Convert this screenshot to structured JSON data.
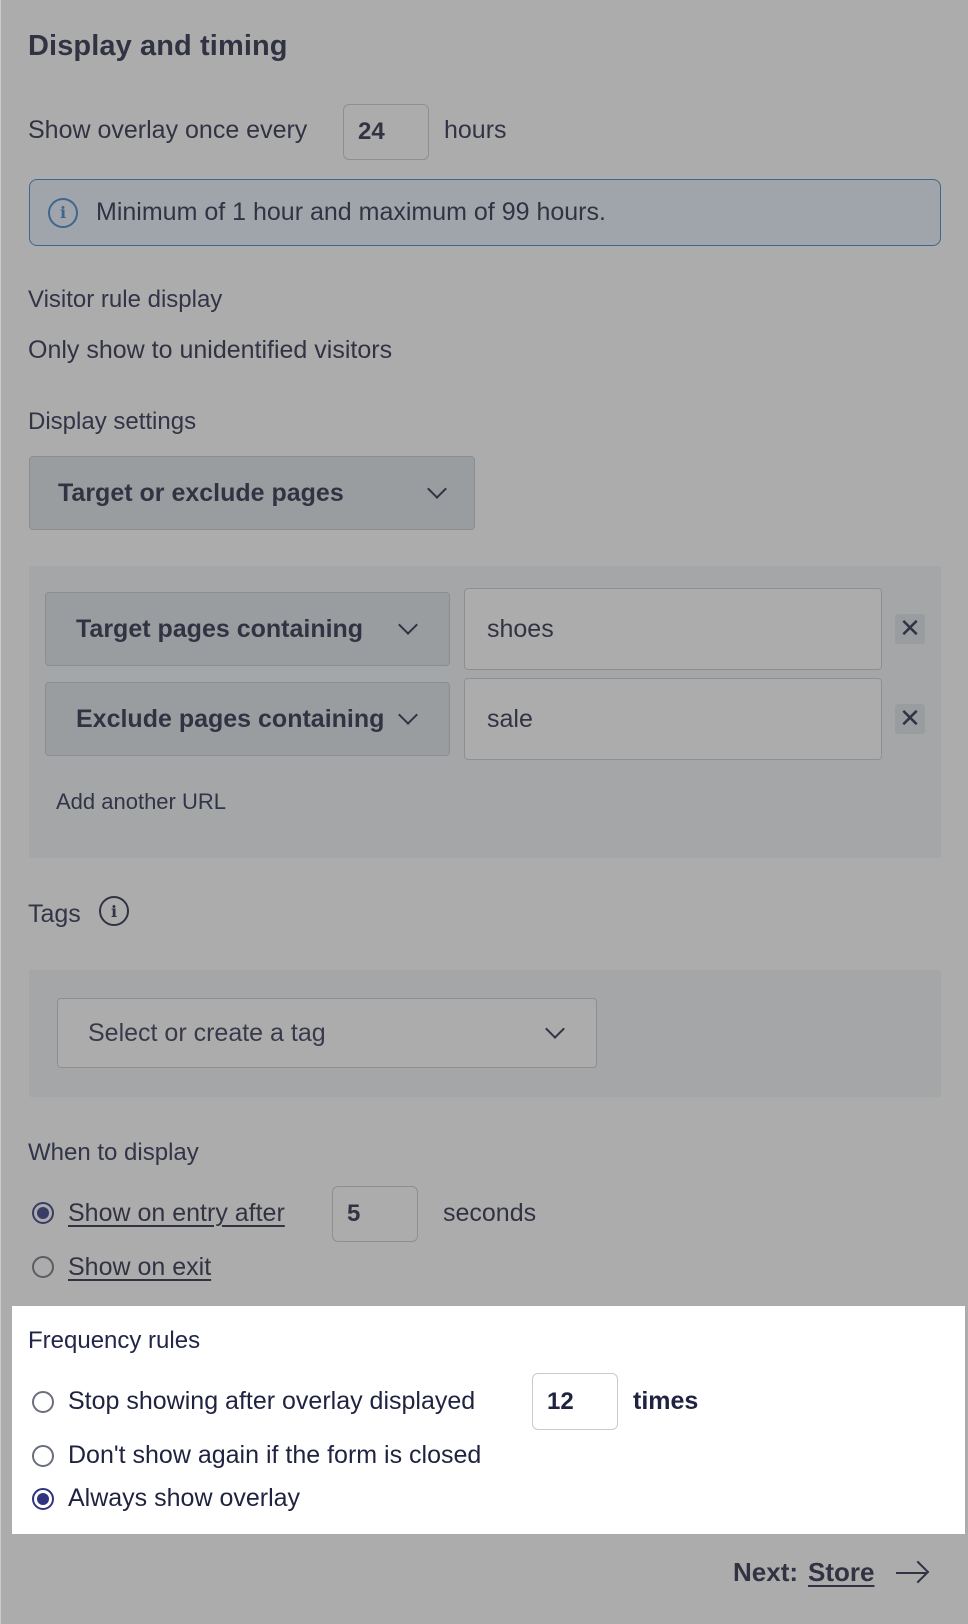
{
  "display_timing": {
    "title": "Display and timing",
    "show_overlay_prefix": "Show overlay once every",
    "hours_value": "24",
    "hours_suffix": "hours",
    "info_text": "Minimum of 1 hour and maximum of 99 hours."
  },
  "visitor_rule": {
    "label": "Visitor rule display",
    "value": "Only show to unidentified visitors"
  },
  "display_settings": {
    "label": "Display settings",
    "select_label": "Target or exclude pages",
    "rules": [
      {
        "type_label": "Target pages containing",
        "value": "shoes"
      },
      {
        "type_label": "Exclude pages containing",
        "value": "sale"
      }
    ],
    "add_url_label": "Add another URL"
  },
  "tags": {
    "label": "Tags",
    "placeholder": "Select or create a tag"
  },
  "when_to_display": {
    "label": "When to display",
    "entry_label": "Show on entry after",
    "entry_value": "5",
    "entry_suffix": "seconds",
    "exit_label": "Show on exit",
    "selected": "entry"
  },
  "frequency_rules": {
    "label": "Frequency rules",
    "stop_label": "Stop showing after overlay displayed",
    "stop_value": "12",
    "stop_suffix": "times",
    "closed_label": "Don't show again if the form is closed",
    "always_label": "Always show overlay",
    "selected": "always"
  },
  "footer": {
    "next_prefix": "Next:",
    "next_target": "Store"
  },
  "colors": {
    "accent": "#2f3480",
    "info_border": "#3b7ec8",
    "info_bg": "#eaf3fd",
    "dim_overlay": "rgba(70,70,70,0.45)"
  },
  "icons": [
    "info-icon",
    "chevron-down-icon",
    "close-icon",
    "arrow-right-icon"
  ]
}
